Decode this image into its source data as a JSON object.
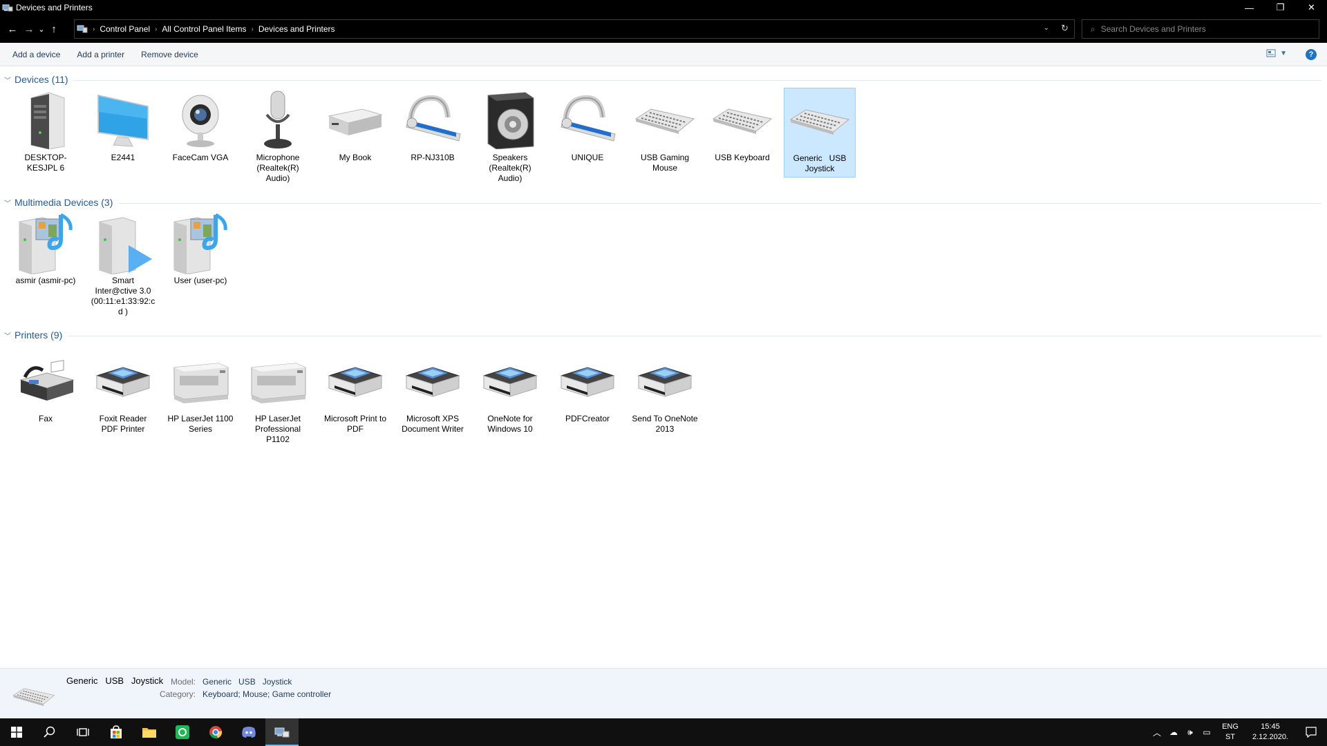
{
  "window": {
    "title": "Devices and Printers",
    "minimize": "—",
    "restore": "❐",
    "close": "✕"
  },
  "address": {
    "back": "←",
    "forward": "→",
    "recent": "⌄",
    "up": "↑",
    "breadcrumb": [
      "Control Panel",
      "All Control Panel Items",
      "Devices and Printers"
    ],
    "search_placeholder": "Search Devices and Printers"
  },
  "commands": {
    "add_device": "Add a device",
    "add_printer": "Add a printer",
    "remove_device": "Remove device",
    "help": "?"
  },
  "groups": {
    "devices": {
      "title": "Devices (11)",
      "items": [
        {
          "label": "DESKTOP-KESJPL 6",
          "icon": "computer-tower-icon"
        },
        {
          "label": "E2441",
          "icon": "monitor-icon"
        },
        {
          "label": "FaceCam VGA",
          "icon": "webcam-icon"
        },
        {
          "label": "Microphone (Realtek(R) Audio)",
          "icon": "microphone-icon"
        },
        {
          "label": "My Book",
          "icon": "external-drive-icon"
        },
        {
          "label": "RP-NJ310B",
          "icon": "headset-icon"
        },
        {
          "label": "Speakers (Realtek(R) Audio)",
          "icon": "speaker-icon"
        },
        {
          "label": "UNIQUE",
          "icon": "headset-icon"
        },
        {
          "label": "USB Gaming Mouse",
          "icon": "keyboard-icon"
        },
        {
          "label": "USB Keyboard",
          "icon": "keyboard-icon"
        },
        {
          "label": "Generic   USB   Joystick",
          "icon": "keyboard-icon",
          "selected": true
        }
      ]
    },
    "multimedia": {
      "title": "Multimedia Devices (3)",
      "items": [
        {
          "label": "asmir (asmir-pc)",
          "icon": "media-server-icon"
        },
        {
          "label": "Smart Inter@ctive 3.0 (00:11:e1:33:92:cd )",
          "icon": "media-renderer-icon"
        },
        {
          "label": "User (user-pc)",
          "icon": "media-server-icon"
        }
      ]
    },
    "printers": {
      "title": "Printers (9)",
      "items": [
        {
          "label": "Fax",
          "icon": "fax-icon"
        },
        {
          "label": "Foxit Reader PDF Printer",
          "icon": "printer-icon"
        },
        {
          "label": "HP LaserJet 1100 Series",
          "icon": "laser-printer-icon"
        },
        {
          "label": "HP LaserJet Professional P1102",
          "icon": "laser-printer-icon"
        },
        {
          "label": "Microsoft Print to PDF",
          "icon": "printer-icon"
        },
        {
          "label": "Microsoft XPS Document Writer",
          "icon": "printer-icon"
        },
        {
          "label": "OneNote for Windows 10",
          "icon": "printer-icon"
        },
        {
          "label": "PDFCreator",
          "icon": "printer-icon"
        },
        {
          "label": "Send To OneNote 2013",
          "icon": "printer-icon"
        }
      ]
    }
  },
  "details": {
    "name": "Generic   USB   Joystick",
    "model_label": "Model:",
    "model_value": "Generic   USB   Joystick",
    "category_label": "Category:",
    "category_value": "Keyboard; Mouse; Game controller"
  },
  "tray": {
    "lang1": "ENG",
    "lang2": "ST",
    "time": "15:45",
    "date": "2.12.2020."
  }
}
